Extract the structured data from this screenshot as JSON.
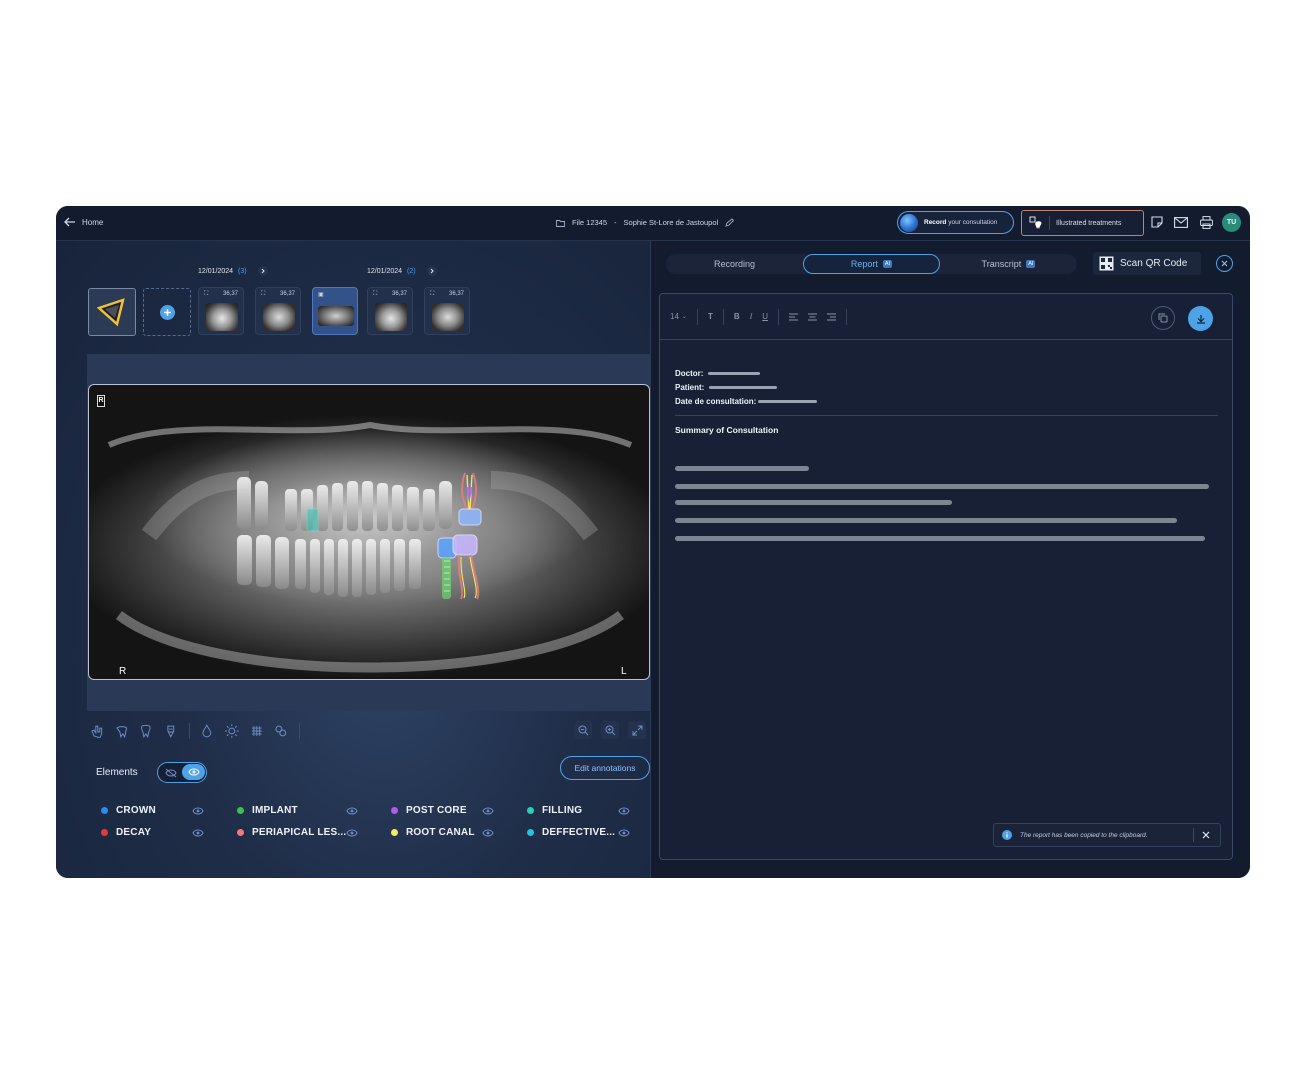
{
  "topbar": {
    "home_label": "Home",
    "file_label": "File 12345",
    "separator": "-",
    "patient_name": "Sophie St-Lore de Jastoupol",
    "record_bold": "Record",
    "record_rest": " your consultation",
    "illustrated_label": "Illustrated treatments",
    "avatar_initials": "TU"
  },
  "gallery": {
    "groups": [
      {
        "date": "12/01/2024",
        "count": "(3)"
      },
      {
        "date": "12/01/2024",
        "count": "(2)"
      }
    ],
    "thumbs": [
      {
        "value": "36,37"
      },
      {
        "value": "36,37"
      },
      {
        "value": ""
      },
      {
        "value": "36,37"
      },
      {
        "value": "36,37"
      }
    ]
  },
  "xray": {
    "corner_mark": "R",
    "left_marker": "R",
    "right_marker": "L"
  },
  "elements": {
    "label": "Elements",
    "edit_button": "Edit annotations",
    "legend": [
      {
        "name": "CROWN",
        "color": "#2b8cf0"
      },
      {
        "name": "IMPLANT",
        "color": "#3fbf4f"
      },
      {
        "name": "POST CORE",
        "color": "#b05cf0"
      },
      {
        "name": "FILLING",
        "color": "#28d0b8"
      },
      {
        "name": "DECAY",
        "color": "#e8383c"
      },
      {
        "name": "PERIAPICAL LES...",
        "color": "#f07a80"
      },
      {
        "name": "ROOT CANAL",
        "color": "#f0ee60"
      },
      {
        "name": "DEFFECTIVE...",
        "color": "#22c2e0"
      }
    ]
  },
  "tabs": {
    "recording": "Recording",
    "report": "Report",
    "transcript": "Transcript",
    "ai_badge": "AI",
    "scan_qr": "Scan QR Code"
  },
  "editor": {
    "font_size": "14",
    "bold": "B",
    "italic": "I",
    "underline": "U",
    "doctor_label": "Doctor:",
    "patient_label": "Patient:",
    "date_label": "Date de consultation:",
    "summary_title": "Summary of Consultation"
  },
  "toast": {
    "message": "The report has been copied to the clipboard."
  },
  "colors": {
    "accent": "#4ea3e6",
    "background": "#131c2e"
  }
}
